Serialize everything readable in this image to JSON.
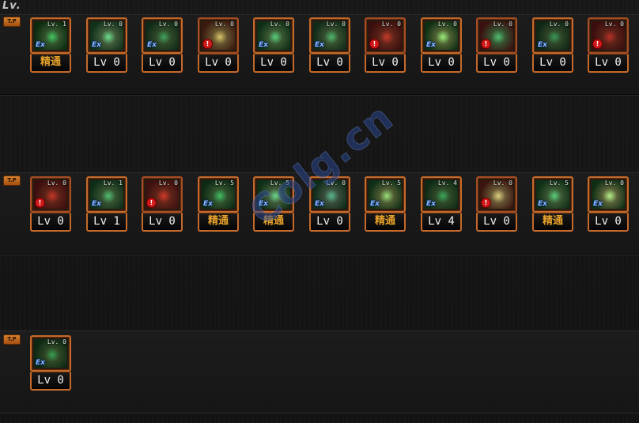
{
  "header": {
    "title": "Lv."
  },
  "tiers": [
    {
      "badge": "T.P",
      "skills": [
        {
          "icon": "skill-icon-eyes-glow",
          "level_tag": "Lv. 1",
          "ex": true,
          "warn": false,
          "bottom": "精通",
          "mastery": true,
          "art": [
            "#0c2a10",
            "#43c764"
          ]
        },
        {
          "icon": "skill-icon-uppercut",
          "level_tag": "Lv. 0",
          "ex": true,
          "warn": false,
          "bottom": "Lv 0",
          "mastery": false,
          "art": [
            "#10301a",
            "#6fe08f"
          ]
        },
        {
          "icon": "skill-icon-fist",
          "level_tag": "Lv. 0",
          "ex": true,
          "warn": false,
          "bottom": "Lv 0",
          "mastery": false,
          "art": [
            "#0f2a18",
            "#3fa65c"
          ]
        },
        {
          "icon": "skill-icon-slash",
          "level_tag": "Lv. 0",
          "ex": false,
          "warn": true,
          "bottom": "Lv 0",
          "mastery": false,
          "art": [
            "#3a1a10",
            "#d8c46a"
          ]
        },
        {
          "icon": "skill-icon-down-arrow",
          "level_tag": "Lv. 0",
          "ex": true,
          "warn": false,
          "bottom": "Lv 0",
          "mastery": false,
          "art": [
            "#0e2e16",
            "#5ad07a"
          ]
        },
        {
          "icon": "skill-icon-kick",
          "level_tag": "Lv. 0",
          "ex": true,
          "warn": false,
          "bottom": "Lv 0",
          "mastery": false,
          "art": [
            "#112a18",
            "#4fb86c"
          ]
        },
        {
          "icon": "skill-icon-crescent",
          "level_tag": "Lv. 0",
          "ex": false,
          "warn": true,
          "bottom": "Lv 0",
          "mastery": false,
          "art": [
            "#3a0e0e",
            "#c73a2a"
          ]
        },
        {
          "icon": "skill-icon-energy-blast",
          "level_tag": "Lv. 0",
          "ex": true,
          "warn": false,
          "bottom": "Lv 0",
          "mastery": false,
          "art": [
            "#0e2e14",
            "#9af07a"
          ]
        },
        {
          "icon": "skill-icon-muscle",
          "level_tag": "Lv. 0",
          "ex": false,
          "warn": true,
          "bottom": "Lv 0",
          "mastery": false,
          "art": [
            "#3a1010",
            "#4fc070"
          ]
        },
        {
          "icon": "skill-icon-dragon",
          "level_tag": "Lv. 0",
          "ex": true,
          "warn": false,
          "bottom": "Lv 0",
          "mastery": false,
          "art": [
            "#0e2614",
            "#3a9a58"
          ]
        },
        {
          "icon": "skill-icon-spark-burst",
          "level_tag": "Lv. 0",
          "ex": false,
          "warn": true,
          "bottom": "Lv 0",
          "mastery": false,
          "art": [
            "#3a0e0e",
            "#b83028"
          ]
        }
      ]
    },
    {
      "badge": "T.P",
      "skills": [
        {
          "icon": "skill-icon-charge",
          "level_tag": "Lv. 0",
          "ex": false,
          "warn": true,
          "bottom": "Lv 0",
          "mastery": false,
          "art": [
            "#3a0e0e",
            "#c73428"
          ]
        },
        {
          "icon": "skill-icon-leap",
          "level_tag": "Lv. 1",
          "ex": true,
          "warn": false,
          "bottom": "Lv 1",
          "mastery": false,
          "art": [
            "#0e2e18",
            "#4fc070"
          ]
        },
        {
          "icon": "skill-icon-explosion",
          "level_tag": "Lv. 0",
          "ex": false,
          "warn": true,
          "bottom": "Lv 0",
          "mastery": false,
          "art": [
            "#3a1010",
            "#d03a2a"
          ]
        },
        {
          "icon": "skill-icon-orb",
          "level_tag": "Lv. 5",
          "ex": true,
          "warn": false,
          "bottom": "精通",
          "mastery": true,
          "art": [
            "#0c2a14",
            "#3fbf66"
          ]
        },
        {
          "icon": "skill-icon-spine",
          "level_tag": "Lv. 5",
          "ex": true,
          "warn": false,
          "bottom": "精通",
          "mastery": true,
          "art": [
            "#0e2e16",
            "#6ad88a"
          ]
        },
        {
          "icon": "skill-icon-dome",
          "level_tag": "Lv. 0",
          "ex": true,
          "warn": false,
          "bottom": "Lv 0",
          "mastery": false,
          "art": [
            "#0e2a1a",
            "#5ab890"
          ]
        },
        {
          "icon": "skill-icon-flex",
          "level_tag": "Lv. 5",
          "ex": true,
          "warn": false,
          "bottom": "精通",
          "mastery": true,
          "art": [
            "#0e2e16",
            "#9ae07a"
          ]
        },
        {
          "icon": "skill-icon-mask",
          "level_tag": "Lv. 4",
          "ex": true,
          "warn": false,
          "bottom": "Lv 4",
          "mastery": false,
          "art": [
            "#0e2a14",
            "#3aa85a"
          ]
        },
        {
          "icon": "skill-icon-standing",
          "level_tag": "Lv. 0",
          "ex": false,
          "warn": true,
          "bottom": "Lv 0",
          "mastery": false,
          "art": [
            "#3a140e",
            "#e0d080"
          ]
        },
        {
          "icon": "skill-icon-swing",
          "level_tag": "Lv. 5",
          "ex": true,
          "warn": false,
          "bottom": "精通",
          "mastery": true,
          "art": [
            "#0e2e16",
            "#5ad07a"
          ]
        },
        {
          "icon": "skill-icon-lightning",
          "level_tag": "Lv. 0",
          "ex": true,
          "warn": false,
          "bottom": "Lv 0",
          "mastery": false,
          "art": [
            "#0e2e14",
            "#b8f08a"
          ]
        }
      ]
    },
    {
      "badge": "T.P",
      "skills": [
        {
          "icon": "skill-icon-demon-face",
          "level_tag": "Lv. 0",
          "ex": true,
          "warn": false,
          "bottom": "Lv 0",
          "mastery": false,
          "art": [
            "#0c2812",
            "#3aa052"
          ]
        }
      ]
    }
  ],
  "watermark": "Colg.cn"
}
